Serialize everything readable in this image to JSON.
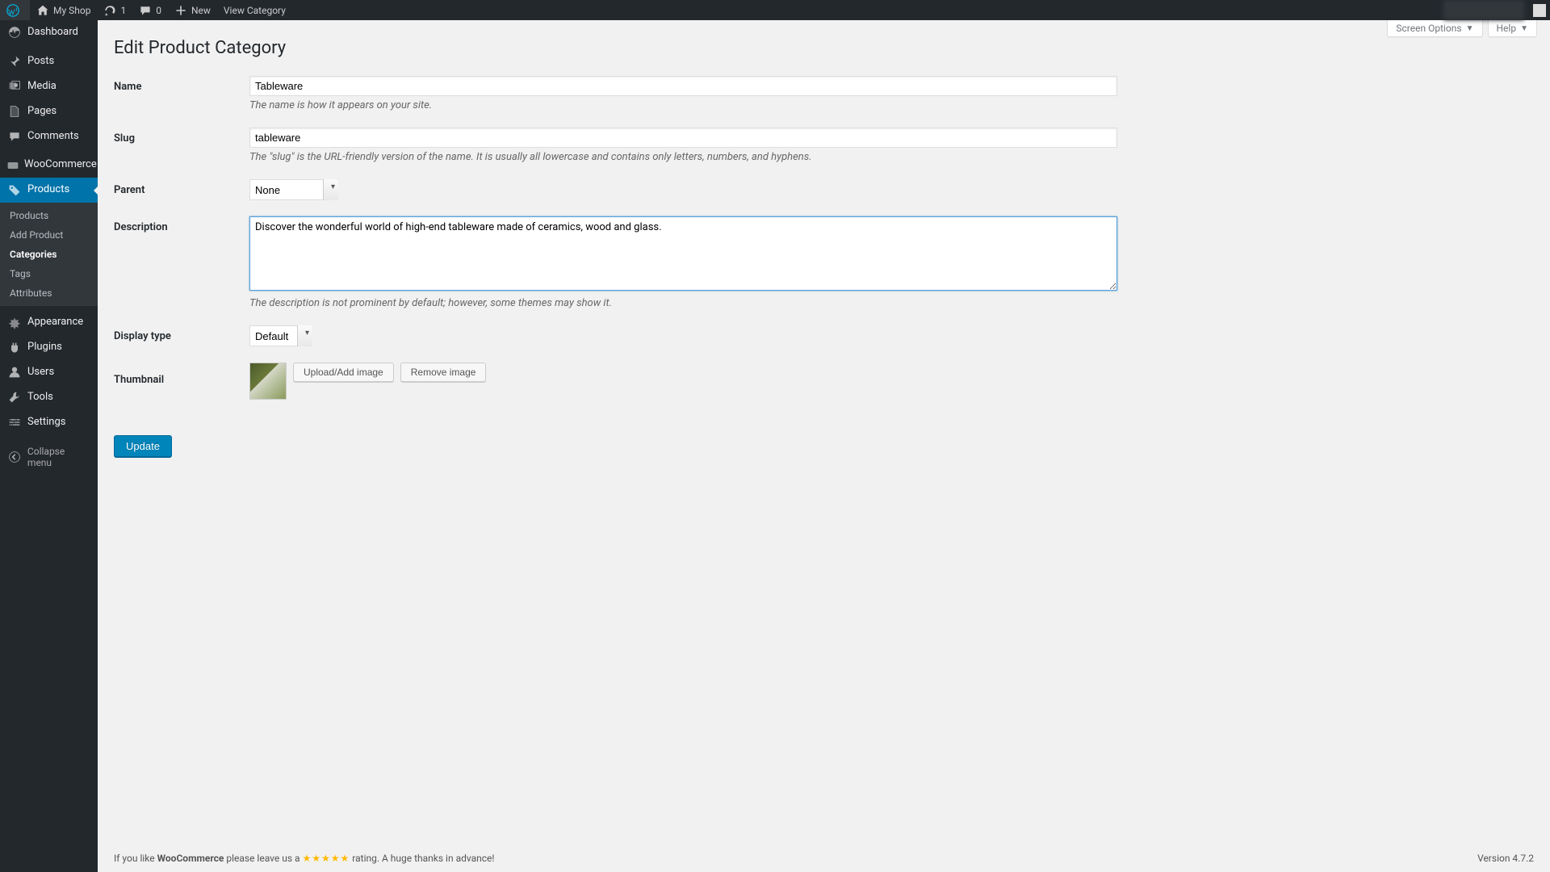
{
  "adminbar": {
    "site_name": "My Shop",
    "updates_count": "1",
    "comments_count": "0",
    "new_label": "New",
    "view_label": "View Category",
    "howdy_user": ""
  },
  "screen_meta": {
    "screen_options": "Screen Options",
    "help": "Help"
  },
  "menu": {
    "dashboard": "Dashboard",
    "posts": "Posts",
    "media": "Media",
    "pages": "Pages",
    "comments": "Comments",
    "woocommerce": "WooCommerce",
    "products": "Products",
    "sub_products": "Products",
    "sub_add": "Add Product",
    "sub_categories": "Categories",
    "sub_tags": "Tags",
    "sub_attributes": "Attributes",
    "appearance": "Appearance",
    "plugins": "Plugins",
    "users": "Users",
    "tools": "Tools",
    "settings": "Settings",
    "collapse": "Collapse menu"
  },
  "page": {
    "title": "Edit Product Category",
    "name_label": "Name",
    "name_value": "Tableware",
    "name_help": "The name is how it appears on your site.",
    "slug_label": "Slug",
    "slug_value": "tableware",
    "slug_help": "The \"slug\" is the URL-friendly version of the name. It is usually all lowercase and contains only letters, numbers, and hyphens.",
    "parent_label": "Parent",
    "parent_value": "None",
    "desc_label": "Description",
    "desc_value": "Discover the wonderful world of high-end tableware made of ceramics, wood and glass.",
    "desc_help": "The description is not prominent by default; however, some themes may show it.",
    "display_label": "Display type",
    "display_value": "Default",
    "thumb_label": "Thumbnail",
    "upload_btn": "Upload/Add image",
    "remove_btn": "Remove image",
    "submit": "Update"
  },
  "footer": {
    "text_pre": "If you like ",
    "text_strong": "WooCommerce",
    "text_mid": " please leave us a ",
    "stars": "★★★★★",
    "text_post": " rating. A huge thanks in advance!",
    "version": "Version 4.7.2"
  }
}
